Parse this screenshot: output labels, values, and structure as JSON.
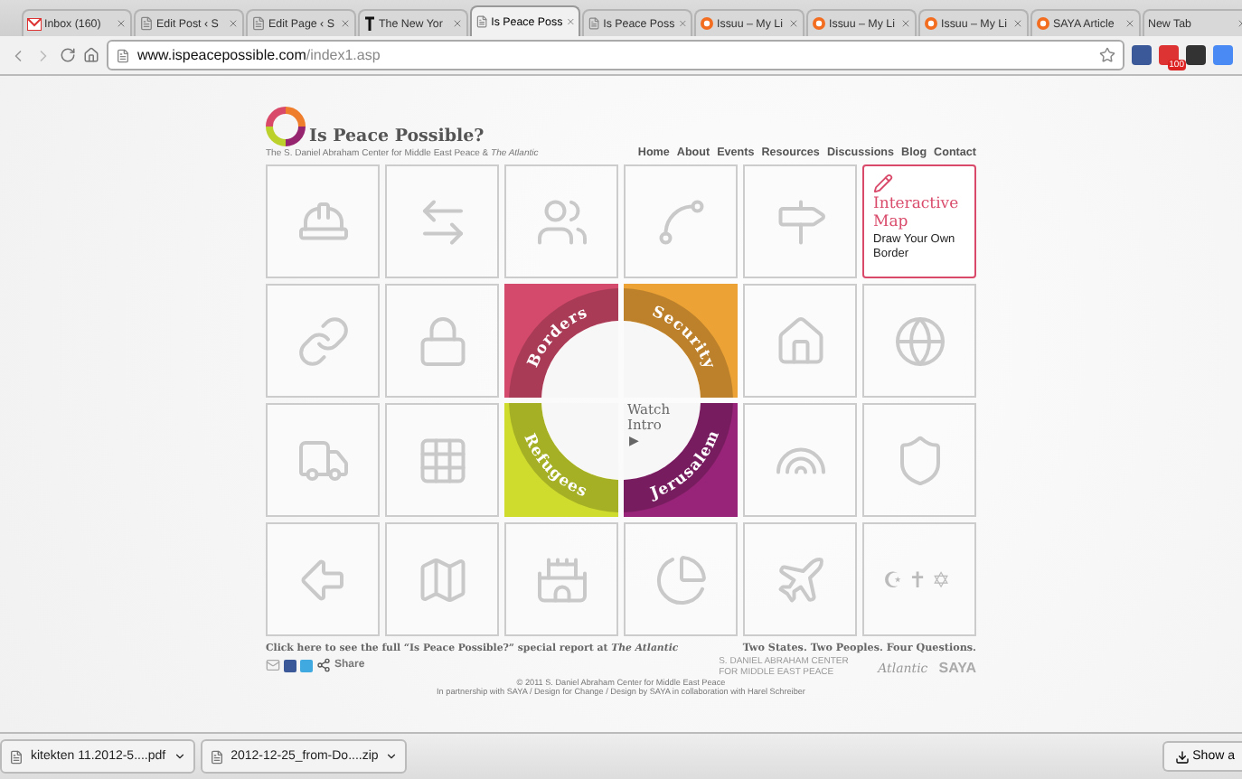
{
  "browser": {
    "tabs": [
      {
        "kind": "gmail",
        "title": "Inbox (160)",
        "selected": false
      },
      {
        "kind": "doc",
        "title": "Edit Post ‹ S",
        "selected": false
      },
      {
        "kind": "doc",
        "title": "Edit Page ‹ S",
        "selected": false
      },
      {
        "kind": "nyt",
        "title": "The New Yor",
        "selected": false
      },
      {
        "kind": "doc",
        "title": "Is Peace Poss",
        "selected": true
      },
      {
        "kind": "doc",
        "title": "Is Peace Poss",
        "selected": false
      },
      {
        "kind": "issuu",
        "title": "Issuu – My Li",
        "selected": false
      },
      {
        "kind": "issuu",
        "title": "Issuu – My Li",
        "selected": false
      },
      {
        "kind": "issuu",
        "title": "Issuu – My Li",
        "selected": false
      },
      {
        "kind": "issuu",
        "title": "SAYA Article",
        "selected": false
      },
      {
        "kind": "none",
        "title": "New Tab",
        "selected": false
      }
    ],
    "address": {
      "host": "www.ispeacepossible.com",
      "path": "/index1.asp"
    },
    "extensions": [
      {
        "kind": "facebook"
      },
      {
        "kind": "gmail",
        "badge": "100"
      },
      {
        "kind": "amazon"
      },
      {
        "kind": "translate"
      }
    ]
  },
  "site": {
    "title": "Is Peace Possible?",
    "subtitle": "The S. Daniel Abraham Center for Middle East Peace & *The Atlantic*",
    "nav": [
      "Home",
      "About",
      "Events",
      "Resources",
      "Discussions",
      "Blog",
      "Contact"
    ]
  },
  "tiles": [
    {
      "kind": "icon"
    },
    {
      "kind": "icon"
    },
    {
      "kind": "icon"
    },
    {
      "kind": "icon"
    },
    {
      "kind": "icon"
    },
    {
      "kind": "feature",
      "title": "Interactive Map",
      "subtitle": "Draw Your Own Border"
    },
    {
      "kind": "icon"
    },
    {
      "kind": "icon"
    },
    {
      "kind": "topic",
      "label": "Borders",
      "color": "#d44a6c"
    },
    {
      "kind": "topic",
      "label": "Security",
      "color": "#eca235"
    },
    {
      "kind": "icon"
    },
    {
      "kind": "icon"
    },
    {
      "kind": "icon"
    },
    {
      "kind": "icon"
    },
    {
      "kind": "topic",
      "label": "Refugees",
      "color": "#cfdc2e"
    },
    {
      "kind": "topic",
      "label": "Jerusalem",
      "color": "#972478"
    },
    {
      "kind": "icon"
    },
    {
      "kind": "icon"
    },
    {
      "kind": "icon"
    },
    {
      "kind": "icon"
    },
    {
      "kind": "icon"
    },
    {
      "kind": "icon"
    },
    {
      "kind": "icon"
    },
    {
      "kind": "symbols",
      "symbols": [
        "☪",
        "✝",
        "✡"
      ]
    }
  ],
  "intro": {
    "label": "Watch Intro",
    "play": "▶"
  },
  "footer": {
    "link": "Click here to see the full “Is Peace Possible?” special report at *The Atlantic*",
    "tagline": "Two States. Two Peoples. Four Questions.",
    "share": "Share",
    "logos": [
      "S. DANIEL ABRAHAM CENTER FOR MIDDLE EAST PEACE",
      "Atlantic",
      "SAYA"
    ],
    "copyright": "© 2011 S. Daniel Abraham Center for Middle East Peace",
    "credits": "In partnership with SAYA / Design for Change / Design by SAYA in collaboration with Harel Schreiber"
  },
  "downloads": {
    "files": [
      "kitekten 11.2012-5....pdf",
      "2012-12-25_from-Do....zip"
    ],
    "show_all": "Show a"
  }
}
